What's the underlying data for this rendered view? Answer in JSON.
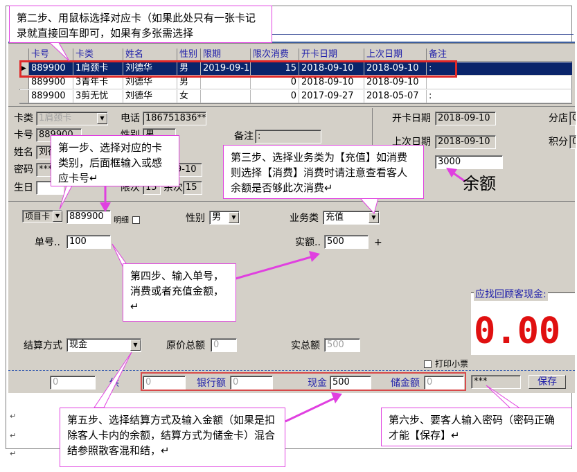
{
  "grid": {
    "headers": [
      "卡号",
      "卡类",
      "姓名",
      "性别",
      "限期",
      "限次消费",
      "开卡日期",
      "上次日期",
      "备注"
    ],
    "rows": [
      {
        "selected": true,
        "cells": [
          "889900",
          "1肩颈卡",
          "刘德华",
          "男",
          "2019-09-1",
          "15",
          "2018-09-10",
          "2018-09-10",
          ":"
        ]
      },
      {
        "selected": false,
        "cells": [
          "889900",
          "3青年卡",
          "刘德华",
          "男",
          "",
          "0",
          "2018-09-10",
          "2018-09-10",
          ""
        ]
      },
      {
        "selected": false,
        "cells": [
          "889900",
          "3剪无忧",
          "刘德华",
          "女",
          "",
          "0",
          "2017-09-27",
          "2018-05-07",
          ":"
        ]
      }
    ]
  },
  "form": {
    "card_type_label": "卡类",
    "card_type_value": "1肩颈卡",
    "phone_label": "电话",
    "phone_value": "186751836**",
    "card_no_label": "卡号",
    "card_no_value": "889900",
    "gender_label_partial": "性别",
    "gender_value_partial": "男",
    "name_label": "姓名",
    "name_value": "刘德华",
    "password_label": "密码",
    "password_value": "***",
    "birthday_label": "生日",
    "expire_value_partial": "9-10",
    "limit_count_label": "限次",
    "limit_count_value": "15",
    "remain_label": "余次",
    "remain_value": "15",
    "remark_label": "备注",
    "remark_value": ":",
    "open_date_label": "开卡日期",
    "open_date_value": "2018-09-10",
    "last_date_label": "上次日期",
    "last_date_value": "2018-09-10",
    "balance_value": "3000",
    "branch_label": "分店",
    "branch_value": "G",
    "points_label": "积分",
    "points_value": "0"
  },
  "transaction": {
    "item_card_select": "项目卡",
    "card_input": "889900",
    "detail_label": "明细",
    "gender_label": "性别",
    "gender_value": "男",
    "business_type_label": "业务类",
    "business_type_value": "充值",
    "order_no_label": "单号..",
    "order_no_value": "100",
    "actual_amount_label": "实额..",
    "actual_amount_value": "500",
    "plus": "+",
    "settle_method_label": "结算方式",
    "settle_method_value": "现金",
    "original_total_label": "原价总额",
    "original_total_value": "0",
    "actual_total_label": "实总额",
    "actual_total_value": "500",
    "print_label": "打印小票",
    "due_title": "应找回顾客现金:",
    "due_amount": "0.00"
  },
  "payment": {
    "left_value": "0",
    "left_label_partial": "供",
    "first_value": "0",
    "bank_label": "银行额",
    "bank_value": "0",
    "cash_label": "现金",
    "cash_value": "500",
    "stored_label": "储金额",
    "stored_value": "0",
    "password_value": "***",
    "save_label": "保存"
  },
  "annotations": {
    "step1": "第一步、选择对应的卡类别，后面框输入或感应卡号↵",
    "step2": "第二步、用鼠标选择对应卡（如果此处只有一张卡记录就直接回车即可，如果有多张需选择",
    "step3": "第三步、选择业务类为【充值】如消费则选择【消费】消费时请注意查看客人余额是否够此次消费↵",
    "step4": "第四步、输入单号，消费或者充值金额，↵",
    "step5": "第五步、选择结算方式及输入金额（如果是扣除客人卡内的余额，结算方式为储金卡）混合结参照散客混和结，↵",
    "step6": "第六步、要客人输入密码（密码正确才能【保存】↵",
    "balance_note": "余额",
    "para_marks": [
      "↵",
      "↵",
      "↵"
    ]
  },
  "colors": {
    "selection": "#0a246a",
    "annotation_border": "#e040e0",
    "highlight_red": "#e02828",
    "due_red": "#e01010",
    "header_blue": "#1d1daa"
  }
}
